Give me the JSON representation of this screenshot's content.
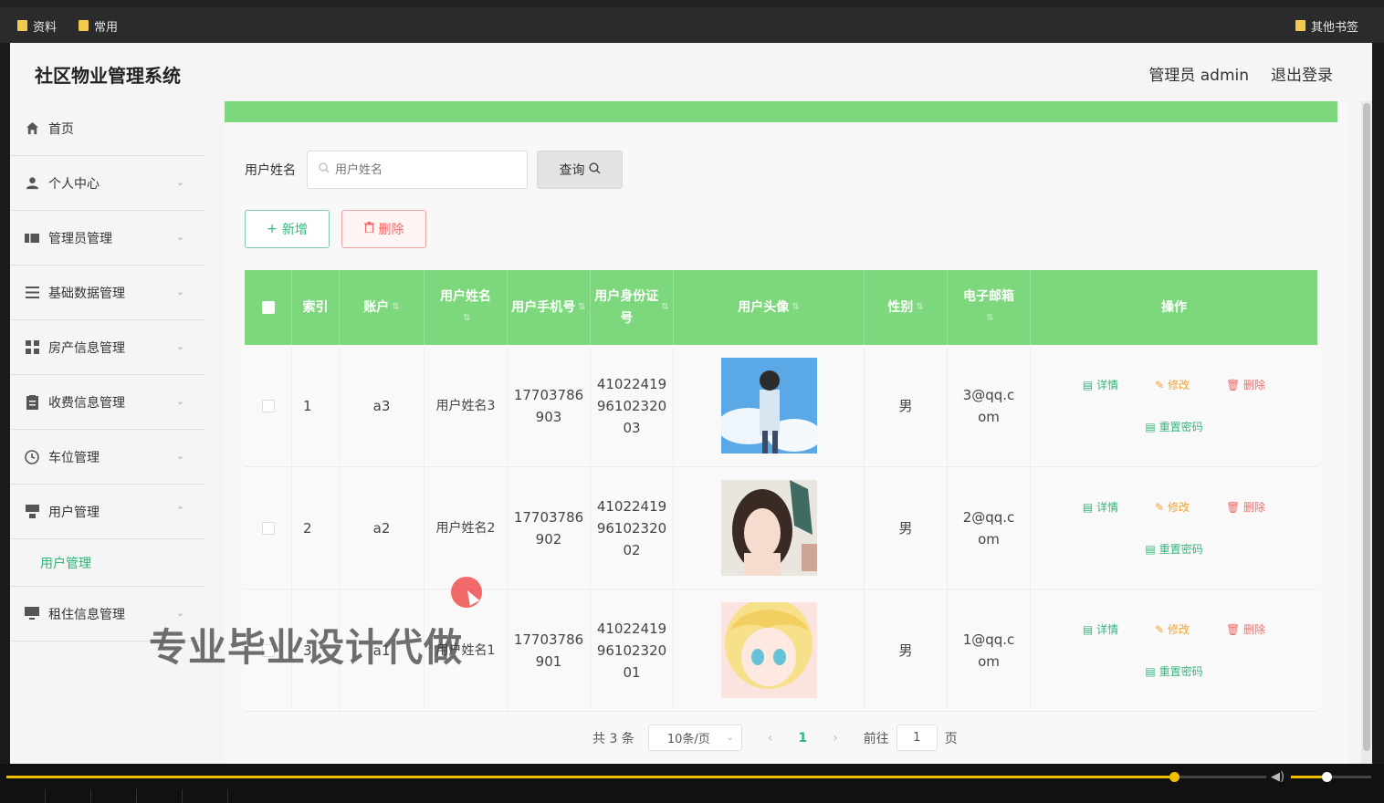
{
  "browser": {
    "bookmarks": [
      "资料",
      "常用"
    ],
    "other_bookmarks": "其他书签"
  },
  "header": {
    "title": "社区物业管理系统",
    "admin": "管理员 admin",
    "logout": "退出登录"
  },
  "sidebar": {
    "items": [
      {
        "label": "首页",
        "icon": "home-icon",
        "glyph": "⌂"
      },
      {
        "label": "个人中心",
        "icon": "user-icon",
        "glyph": "👤"
      },
      {
        "label": "管理员管理",
        "icon": "ticket-icon",
        "glyph": "▬"
      },
      {
        "label": "基础数据管理",
        "icon": "list-icon",
        "glyph": "☰"
      },
      {
        "label": "房产信息管理",
        "icon": "grid-icon",
        "glyph": "▦"
      },
      {
        "label": "收费信息管理",
        "icon": "document-icon",
        "glyph": "▤"
      },
      {
        "label": "车位管理",
        "icon": "clock-icon",
        "glyph": "◷"
      },
      {
        "label": "用户管理",
        "icon": "user-card-icon",
        "glyph": "▀"
      },
      {
        "label": "租住信息管理",
        "icon": "monitor-icon",
        "glyph": "▭"
      }
    ],
    "submenu_active": "用户管理"
  },
  "search": {
    "label": "用户姓名",
    "placeholder": "用户姓名",
    "button": "查询"
  },
  "actions": {
    "add": "新增",
    "delete": "删除"
  },
  "table": {
    "headers": [
      "索引",
      "账户",
      "用户姓名",
      "用户手机号",
      "用户身份证号",
      "用户头像",
      "性别",
      "电子邮箱",
      "操作"
    ],
    "rows": [
      {
        "index": "1",
        "account": "a3",
        "name": "用户姓名3",
        "phone": "17703786903",
        "id_card": "410224199610232003",
        "gender": "男",
        "email": "3@qq.com",
        "avatar": "boy-sky"
      },
      {
        "index": "2",
        "account": "a2",
        "name": "用户姓名2",
        "phone": "17703786902",
        "id_card": "410224199610232002",
        "gender": "男",
        "email": "2@qq.com",
        "avatar": "girl-dark-hair"
      },
      {
        "index": "3",
        "account": "a1",
        "name": "用户姓名1",
        "phone": "17703786901",
        "id_card": "410224199610232001",
        "gender": "男",
        "email": "1@qq.com",
        "avatar": "anime-blonde"
      }
    ],
    "ops": {
      "detail": "详情",
      "edit": "修改",
      "delete": "删除",
      "reset": "重置密码"
    }
  },
  "pagination": {
    "total": "共 3 条",
    "page_size": "10条/页",
    "current": "1",
    "goto_label": "前往",
    "goto_value": "1",
    "page_suffix": "页"
  },
  "watermark": "专业毕业设计代做",
  "video": {
    "progress": 0.927,
    "volume": 0.44
  },
  "colors": {
    "accent_green": "#7dd87d",
    "link_green": "#33b67a",
    "edit_orange": "#f0a433",
    "delete_red": "#f26b6b"
  }
}
